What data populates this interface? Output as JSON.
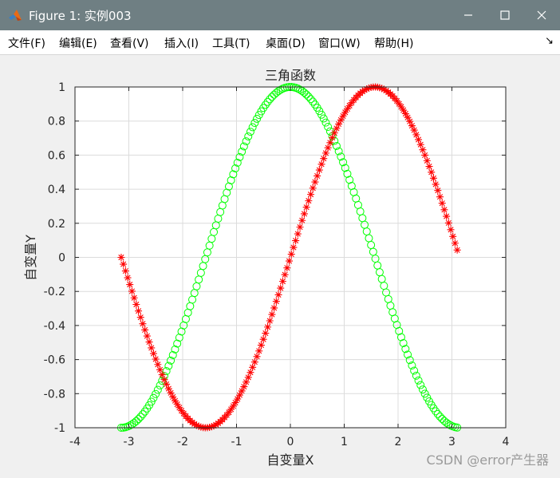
{
  "window": {
    "title": "Figure 1: 实例003",
    "controls": {
      "minimize": "—",
      "maximize": "☐",
      "close": "✕"
    }
  },
  "menubar": {
    "items": [
      {
        "label": "文件(F)"
      },
      {
        "label": "编辑(E)"
      },
      {
        "label": "查看(V)"
      },
      {
        "label": "插入(I)"
      },
      {
        "label": "工具(T)"
      },
      {
        "label": "桌面(D)"
      },
      {
        "label": "窗口(W)"
      },
      {
        "label": "帮助(H)"
      }
    ],
    "dock_arrow": "↘"
  },
  "watermark": "CSDN @error产生器",
  "chart_data": {
    "type": "scatter",
    "title": "三角函数",
    "xlabel": "自变量X",
    "ylabel": "自变量Y",
    "xlim": [
      -4,
      4
    ],
    "ylim": [
      -1,
      1
    ],
    "xticks": [
      "-4",
      "-3",
      "-2",
      "-1",
      "0",
      "1",
      "2",
      "3",
      "4"
    ],
    "yticks": [
      "-1",
      "-0.8",
      "-0.6",
      "-0.4",
      "-0.2",
      "0",
      "0.2",
      "0.4",
      "0.6",
      "0.8",
      "1"
    ],
    "grid": true,
    "x_range": [
      -3.1416,
      3.1016
    ],
    "x_step": 0.04,
    "series": [
      {
        "function": "sin(x)",
        "marker": "asterisk",
        "color": "#ff0000"
      },
      {
        "function": "cos(x)",
        "marker": "circle",
        "color": "#00ff00"
      }
    ]
  }
}
